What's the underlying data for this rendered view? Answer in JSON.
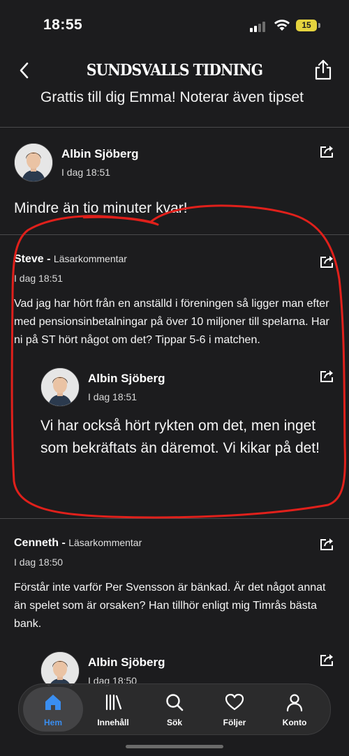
{
  "status_bar": {
    "time": "18:55",
    "battery": "15",
    "battery_color": "#e5d33e"
  },
  "header": {
    "title": "SUNDSVALLS TIDNING",
    "back_icon": "chevron-left-icon",
    "share_icon": "share-icon"
  },
  "feed": {
    "partial_top_text": "Grattis till dig Emma! Noterar även tipset",
    "staff_post": {
      "author": "Albin Sjöberg",
      "time": "I dag 18:51",
      "text": "Mindre än tio minuter kvar!"
    },
    "reader_post_1": {
      "name": "Steve",
      "separator": " - ",
      "label": "Läsarkommentar",
      "time": "I dag 18:51",
      "text": "Vad jag har hört från en anställd i föreningen så ligger man efter med pensionsinbetalningar på över 10 miljoner till spelarna. Har ni på ST hört något om det? Tippar 5-6 i matchen.",
      "reply": {
        "author": "Albin Sjöberg",
        "time": "I dag 18:51",
        "text": "Vi har också hört rykten om det, men inget som bekräftats än däremot. Vi kikar på det!"
      }
    },
    "reader_post_2": {
      "name": "Cenneth",
      "separator": " - ",
      "label": "Läsarkommentar",
      "time": "I dag 18:50",
      "text": "Förstår inte varför Per Svensson är bänkad. Är det något annat än spelet som är orsaken? Han tillhör enligt mig Timrås bästa bank.",
      "reply": {
        "author": "Albin Sjöberg",
        "time": "I dag 18:50"
      }
    }
  },
  "tab_bar": {
    "accent_color": "#3a8ef0",
    "tabs": [
      {
        "label": "Hem",
        "icon": "home-icon"
      },
      {
        "label": "Innehåll",
        "icon": "library-icon"
      },
      {
        "label": "Sök",
        "icon": "search-icon"
      },
      {
        "label": "Följer",
        "icon": "heart-icon"
      },
      {
        "label": "Konto",
        "icon": "person-icon"
      }
    ]
  },
  "annotation_color": "#e0201b"
}
